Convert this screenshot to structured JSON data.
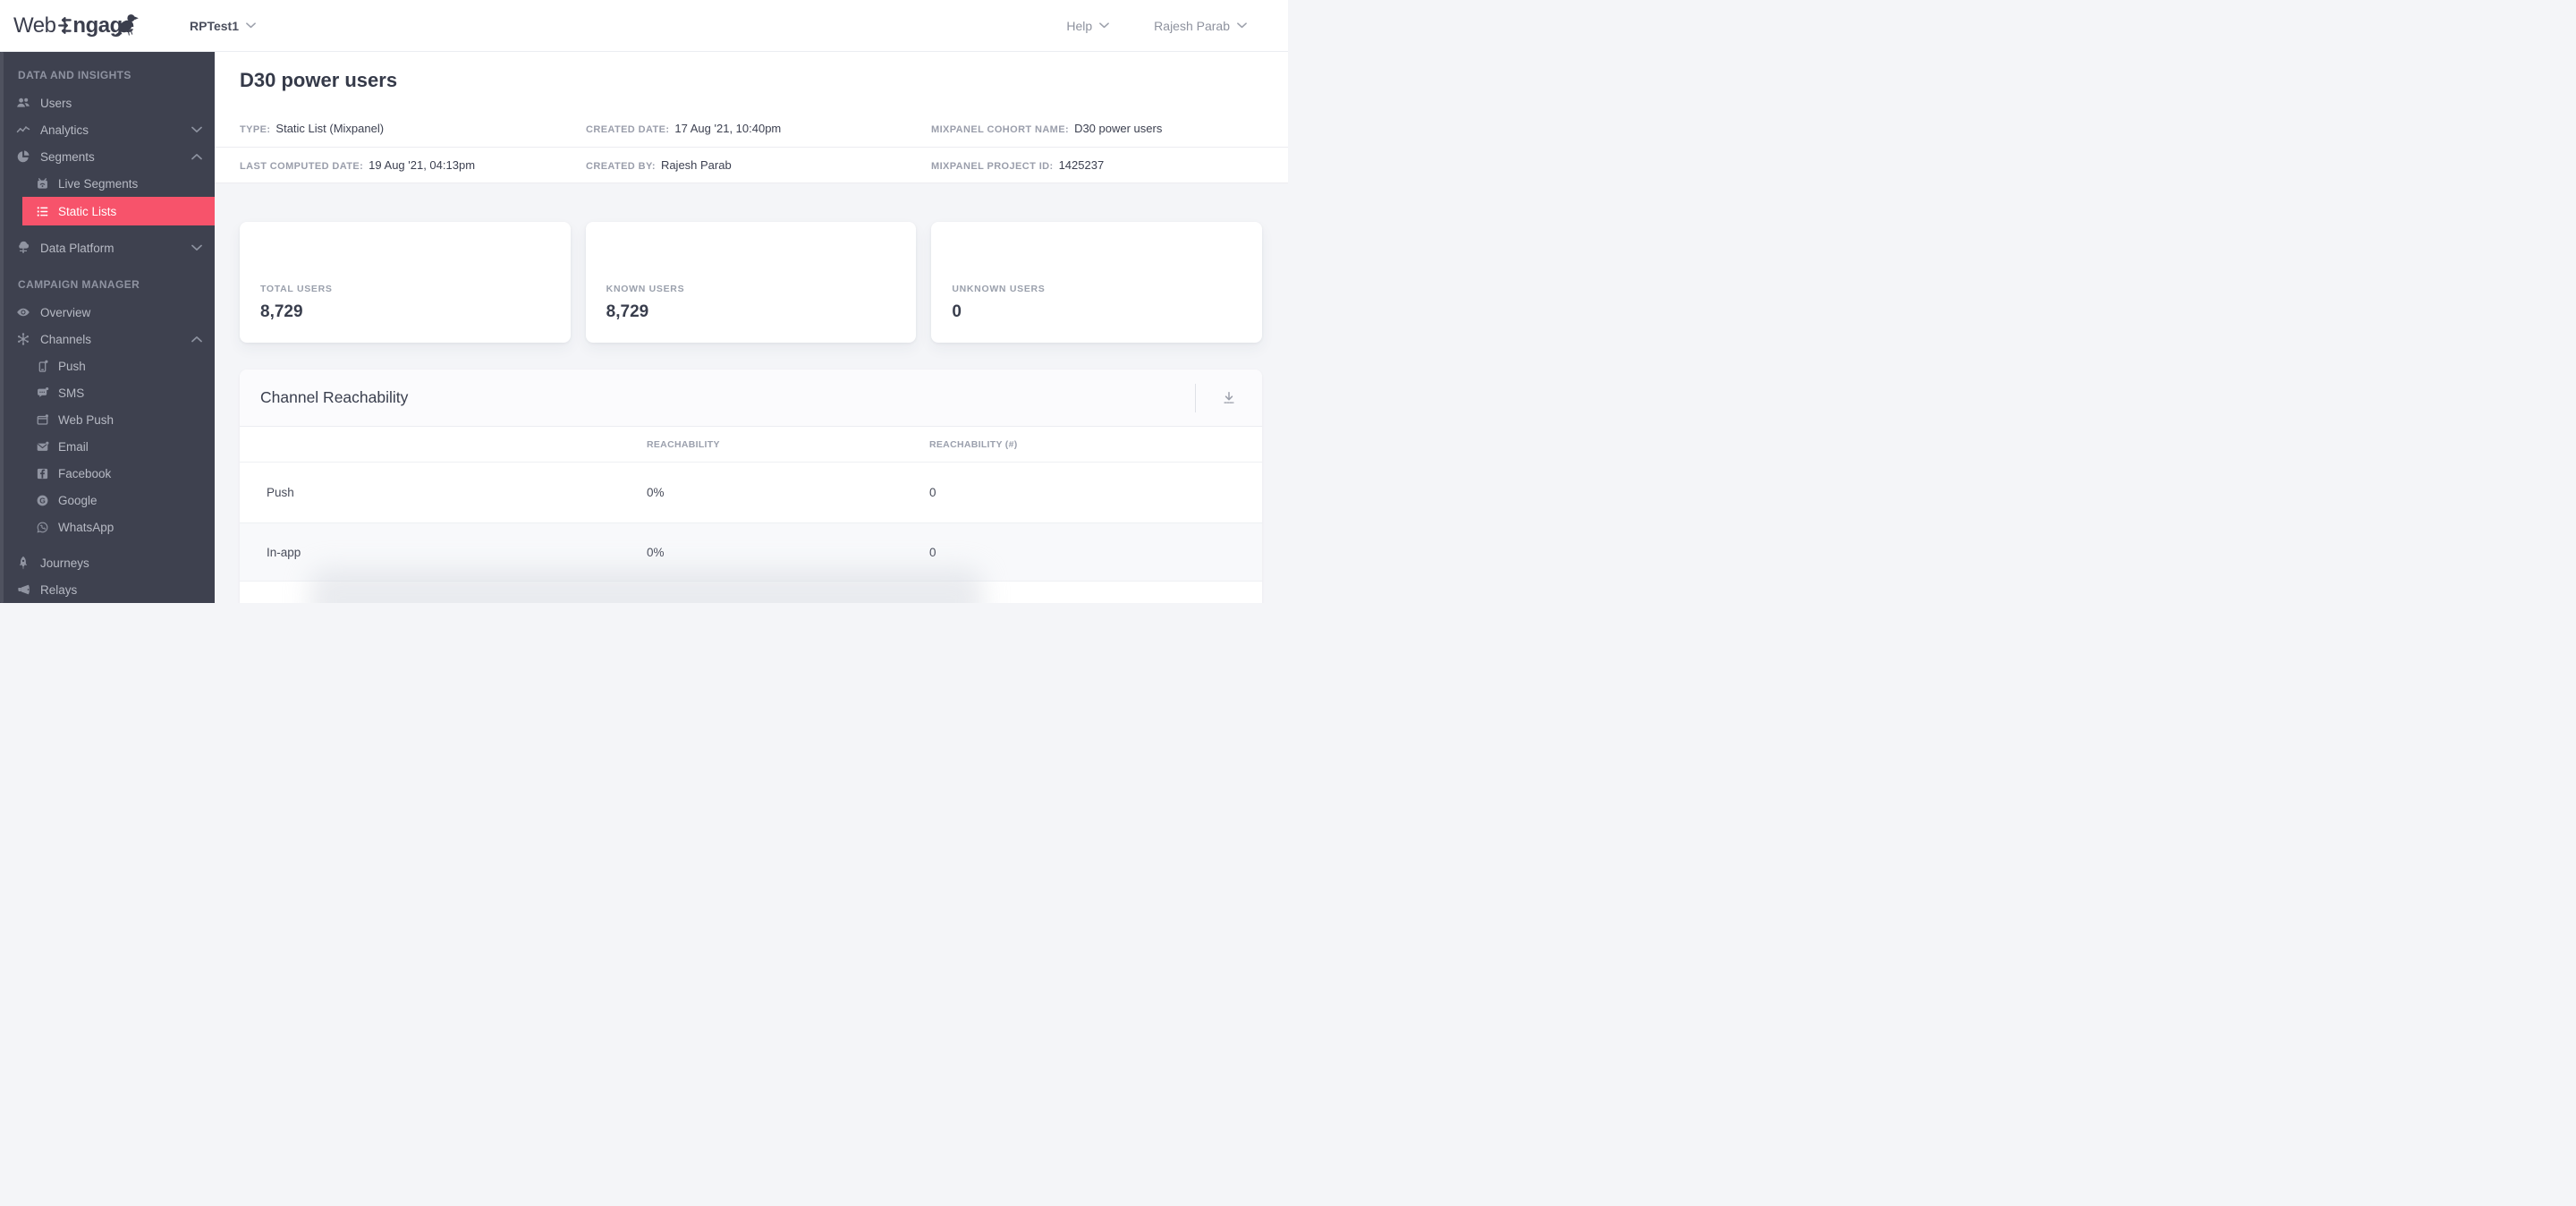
{
  "topbar": {
    "logo_web": "Web",
    "logo_engage": "ngage",
    "project_name": "RPTest1",
    "help_label": "Help",
    "user_name": "Rajesh Parab"
  },
  "sidebar": {
    "section_data_insights": "DATA AND INSIGHTS",
    "users": "Users",
    "analytics": "Analytics",
    "segments": "Segments",
    "live_segments": "Live Segments",
    "static_lists": "Static Lists",
    "data_platform": "Data Platform",
    "section_campaign_manager": "CAMPAIGN MANAGER",
    "overview": "Overview",
    "channels": "Channels",
    "push": "Push",
    "sms": "SMS",
    "web_push": "Web Push",
    "email": "Email",
    "facebook": "Facebook",
    "google": "Google",
    "whatsapp": "WhatsApp",
    "journeys": "Journeys",
    "relays": "Relays"
  },
  "page": {
    "title": "D30 power users",
    "meta": {
      "type_label": "TYPE:",
      "type_value": "Static List (Mixpanel)",
      "created_date_label": "CREATED DATE:",
      "created_date_value": "17 Aug '21, 10:40pm",
      "cohort_name_label": "MIXPANEL COHORT NAME:",
      "cohort_name_value": "D30 power users",
      "last_computed_label": "LAST COMPUTED DATE:",
      "last_computed_value": "19 Aug '21, 04:13pm",
      "created_by_label": "CREATED BY:",
      "created_by_value": "Rajesh Parab",
      "project_id_label": "MIXPANEL PROJECT ID:",
      "project_id_value": "1425237"
    },
    "stats": [
      {
        "label": "TOTAL USERS",
        "value": "8,729"
      },
      {
        "label": "KNOWN USERS",
        "value": "8,729"
      },
      {
        "label": "UNKNOWN USERS",
        "value": "0"
      }
    ],
    "reachability": {
      "title": "Channel Reachability",
      "col_reachability": "REACHABILITY",
      "col_reachability_count": "REACHABILITY (#)",
      "rows": [
        {
          "channel": "Push",
          "reachability": "0%",
          "count": "0"
        },
        {
          "channel": "In-app",
          "reachability": "0%",
          "count": "0"
        }
      ]
    }
  },
  "colors": {
    "accent_pink": "#f7536b",
    "sidebar_bg": "#3e414f",
    "content_bg": "#f4f5f8"
  }
}
